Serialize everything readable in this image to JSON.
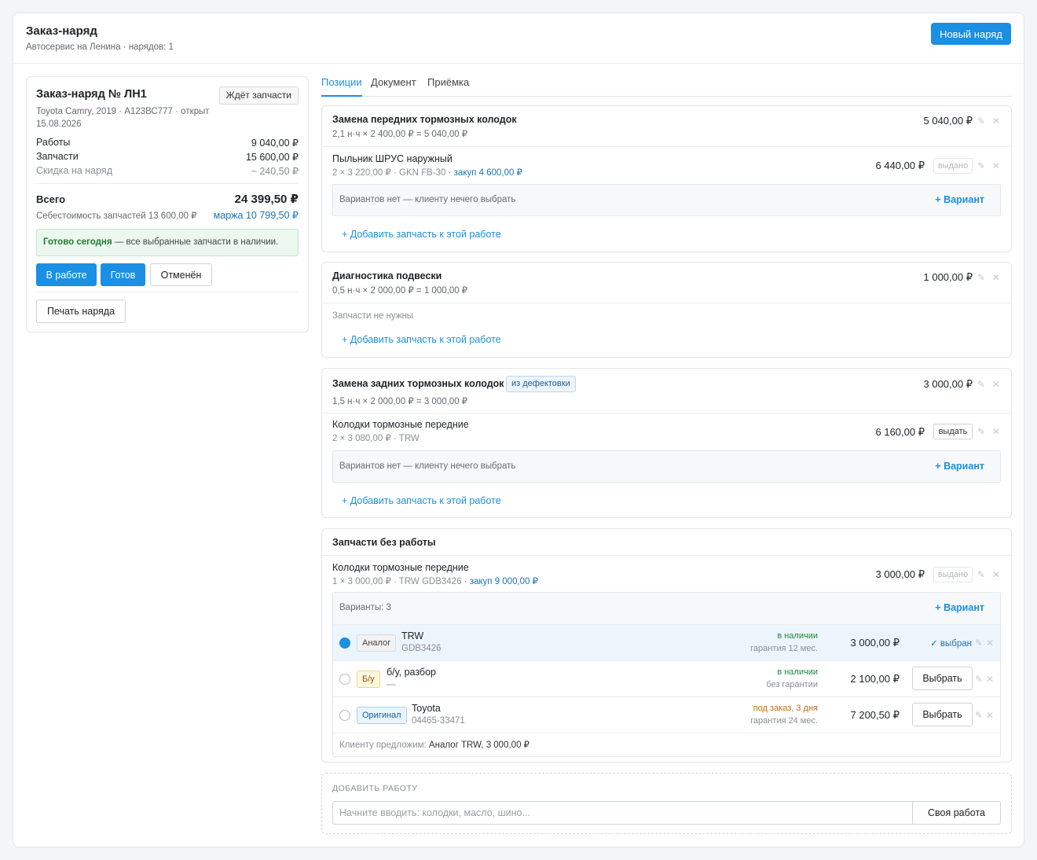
{
  "header": {
    "title": "Заказ-наряд",
    "subtitle": "Автосервис на Ленина · нарядов: 1",
    "new_order_label": "Новый наряд"
  },
  "order": {
    "title": "Заказ-наряд № ЛН1",
    "status": "Ждёт запчасти",
    "car": "Toyota Camry, 2019 · А123ВС777 · открыт 15.08.2026",
    "works_label": "Работы",
    "works_value": "9 040,00 ₽",
    "parts_label": "Запчасти",
    "parts_value": "15 600,00 ₽",
    "discount_label": "Скидка на наряд",
    "discount_value": "− 240,50 ₽",
    "total_label": "Всего",
    "total_value": "24 399,50 ₽",
    "cost_label": "Себестоимость запчастей 13 600,00 ₽",
    "margin_label": "маржа 10 799,50 ₽",
    "ready_bold": "Готово сегодня",
    "ready_text": " — все выбранные запчасти в наличии.",
    "btn_in_work": "В работе",
    "btn_done": "Готов",
    "btn_cancelled": "Отменён",
    "btn_print": "Печать наряда"
  },
  "tabs": [
    "Позиции",
    "Документ",
    "Приёмка"
  ],
  "jobs": [
    {
      "title": "Замена передних тормозных колодок",
      "formula": "2,1 н·ч × 2 400,00 ₽ = 5 040,00 ₽",
      "price": "5 040,00 ₽",
      "part_name": "Пыльник ШРУС наружный",
      "part_sub": "2 × 3 220,00 ₽ · GKN FB-30 · ",
      "part_purchase": "закуп 4 600,00 ₽",
      "part_price": "6 440,00 ₽",
      "issue_label": "выдано",
      "variants_text": "Вариантов нет — клиенту нечего выбрать",
      "variant_link": "+ Вариант",
      "add_part": "+ Добавить запчасть к этой работе"
    },
    {
      "title": "Диагностика подвески",
      "formula": "0,5 н·ч × 2 000,00 ₽ = 1 000,00 ₽",
      "price": "1 000,00 ₽",
      "hint": "Запчасти не нужны",
      "add_part": "+ Добавить запчасть к этой работе"
    },
    {
      "title": "Замена задних тормозных колодок",
      "tag": "из дефектовки",
      "formula": "1,5 н·ч × 2 000,00 ₽ = 3 000,00 ₽",
      "price": "3 000,00 ₽",
      "part_name": "Колодки тормозные передние",
      "part_sub": "2 × 3 080,00 ₽ · TRW",
      "part_price": "6 160,00 ₽",
      "issue_label": "выдать",
      "variants_text": "Вариантов нет — клиенту нечего выбрать",
      "variant_link": "+ Вариант",
      "add_part": "+ Добавить запчасть к этой работе"
    }
  ],
  "no_work": {
    "title": "Запчасти без работы",
    "part_name": "Колодки тормозные передние",
    "part_sub": "1 × 3 000,00 ₽ · TRW GDB3426 · ",
    "part_purchase": "закуп 9 000,00 ₽",
    "part_price": "3 000,00 ₽",
    "issue_label": "выдано",
    "variants_count": "Варианты: 3",
    "variant_link": "+ Вариант",
    "variants": [
      {
        "tag": "Аналог",
        "name": "TRW",
        "code": "GDB3426",
        "stock": "в наличии",
        "warranty": "гарантия 12 мес.",
        "price": "3 000,00 ₽",
        "action": "✓ выбран"
      },
      {
        "tag": "Б/у",
        "name": "б/у, разбор",
        "code": "—",
        "stock": "в наличии",
        "warranty": "без гарантии",
        "price": "2 100,00 ₽",
        "action": "Выбрать"
      },
      {
        "tag": "Оригинал",
        "name": "Toyota",
        "code": "04465-33471",
        "stock": "под заказ, 3 дня",
        "warranty": "гарантия 24 мес.",
        "price": "7 200,50 ₽",
        "action": "Выбрать"
      }
    ],
    "offer_label": "Клиенту предложим: ",
    "offer_value": "Аналог TRW, 3 000,00 ₽"
  },
  "add_work": {
    "label": "ДОБАВИТЬ РАБОТУ",
    "placeholder": "Начните вводить: колодки, масло, шино...",
    "custom_label": "Своя работа"
  },
  "colors": {
    "accent": "#1a8fe3",
    "success": "#1d8a3a",
    "warning": "#c86a10"
  },
  "icons": [
    "pencil-icon",
    "close-icon",
    "check-icon"
  ]
}
